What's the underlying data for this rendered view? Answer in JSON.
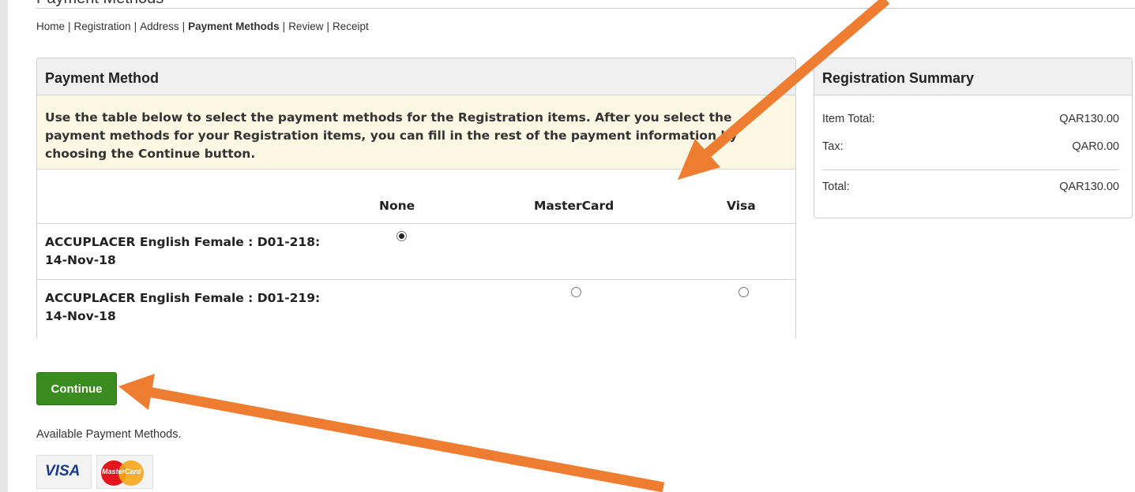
{
  "page": {
    "heading": "Payment Methods"
  },
  "breadcrumb": {
    "items": [
      {
        "label": "Home"
      },
      {
        "label": "Registration"
      },
      {
        "label": "Address"
      },
      {
        "label": "Payment Methods",
        "current": true
      },
      {
        "label": "Review"
      },
      {
        "label": "Receipt"
      }
    ],
    "separator": "|"
  },
  "payment_panel": {
    "title": "Payment Method",
    "instructions": "Use the table below to select the payment methods for the Registration items. After you select the payment methods for your Registration items, you can fill in the rest of the payment information by choosing the Continue button.",
    "columns": [
      "None",
      "MasterCard",
      "Visa"
    ],
    "rows": [
      {
        "label": "ACCUPLACER English Female : D01-218: 14-Nov-18",
        "none": "checked",
        "mastercard": null,
        "visa": null
      },
      {
        "label": "ACCUPLACER English Female : D01-219: 14-Nov-18",
        "none": null,
        "mastercard": "unchecked",
        "visa": "unchecked"
      }
    ]
  },
  "summary_panel": {
    "title": "Registration Summary",
    "item_total_label": "Item Total:",
    "item_total_value": "QAR130.00",
    "tax_label": "Tax:",
    "tax_value": "QAR0.00",
    "total_label": "Total:",
    "total_value": "QAR130.00"
  },
  "actions": {
    "continue_label": "Continue"
  },
  "available_methods": {
    "label": "Available Payment Methods.",
    "cards": [
      {
        "name": "VISA",
        "icon": "visa-card-icon"
      },
      {
        "name": "MasterCard",
        "icon": "mastercard-card-icon"
      }
    ]
  },
  "annotations": {
    "arrow_color": "#ef7d31"
  },
  "colors": {
    "button_green": "#3b8c1f",
    "instructions_bg": "#fdf8e4",
    "panel_header_bg": "#f0f0f0"
  }
}
